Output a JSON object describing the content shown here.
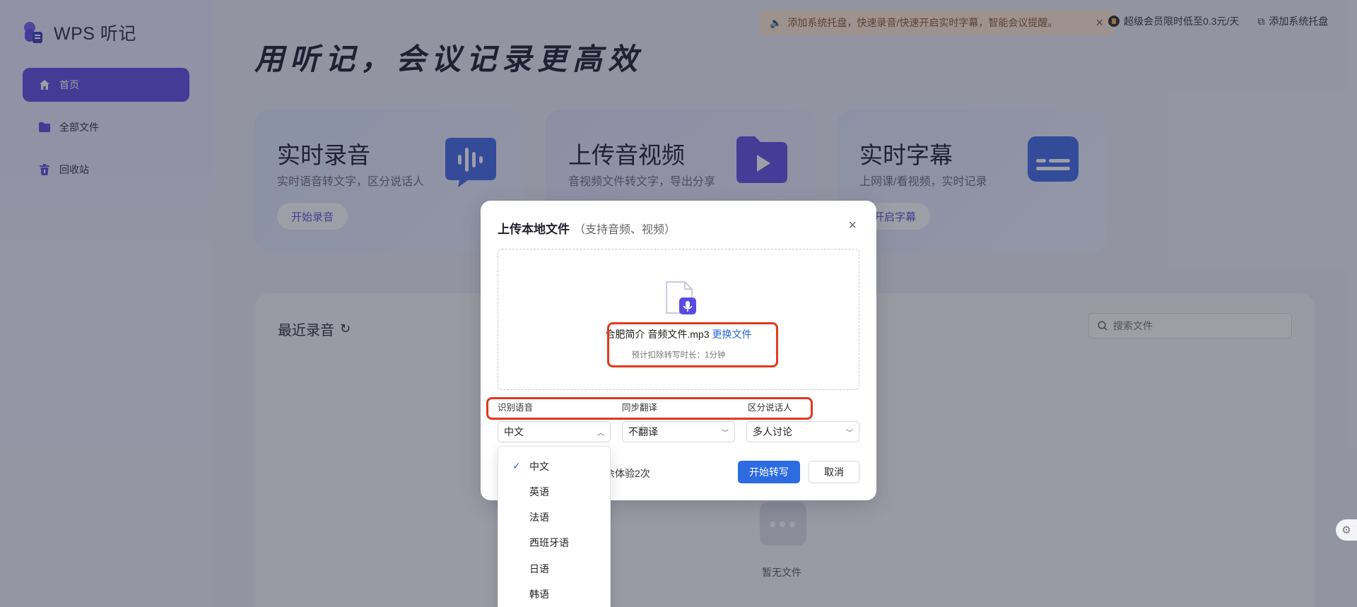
{
  "app": {
    "name": "WPS 听记"
  },
  "sidebar": {
    "items": [
      {
        "label": "首页",
        "icon": "home-icon",
        "active": true
      },
      {
        "label": "全部文件",
        "icon": "folder-icon",
        "active": false
      },
      {
        "label": "回收站",
        "icon": "trash-icon",
        "active": false
      }
    ]
  },
  "topbar": {
    "notice": "添加系统托盘，快速录音/快速开启实时字幕，智能会议提醒。",
    "vip": "超级会员限时低至0.3元/天",
    "tray": "添加系统托盘"
  },
  "hero": {
    "title": "用听记，会议记录更高效"
  },
  "cards": [
    {
      "title": "实时录音",
      "sub": "实时语音转文字，区分说话人",
      "button": "开始录音",
      "icon": "waveform-icon"
    },
    {
      "title": "上传音视频",
      "sub": "音视频文件转文字，导出分享",
      "button": "",
      "icon": "video-folder-icon"
    },
    {
      "title": "实时字幕",
      "sub": "上网课/看视频，实时记录",
      "button": "开启字幕",
      "icon": "subtitle-icon"
    }
  ],
  "recent": {
    "title": "最近录音",
    "search_placeholder": "搜索文件",
    "empty": "暂无文件"
  },
  "dialog": {
    "title": "上传本地文件",
    "hint": "（支持音频、视频）",
    "file_name": "合肥简介 音频文件.mp3",
    "change_file": "更换文件",
    "estimate": "预计扣除转写时长：1分钟",
    "labels": {
      "language": "识别语音",
      "translate": "同步翻译",
      "speaker": "区分说话人"
    },
    "selects": {
      "language": "中文",
      "translate": "不翻译",
      "speaker": "多人讨论"
    },
    "quota": "余体验2次",
    "start": "开始转写",
    "cancel": "取消"
  },
  "language_options": [
    {
      "label": "中文",
      "selected": true
    },
    {
      "label": "英语",
      "selected": false
    },
    {
      "label": "法语",
      "selected": false
    },
    {
      "label": "西班牙语",
      "selected": false
    },
    {
      "label": "日语",
      "selected": false
    },
    {
      "label": "韩语",
      "selected": false
    }
  ],
  "colors": {
    "accent": "#5a4be0",
    "primary_button": "#2c6be0",
    "link": "#2664d8",
    "highlight": "#e03a1e",
    "notice_bg": "#fde9d2"
  }
}
